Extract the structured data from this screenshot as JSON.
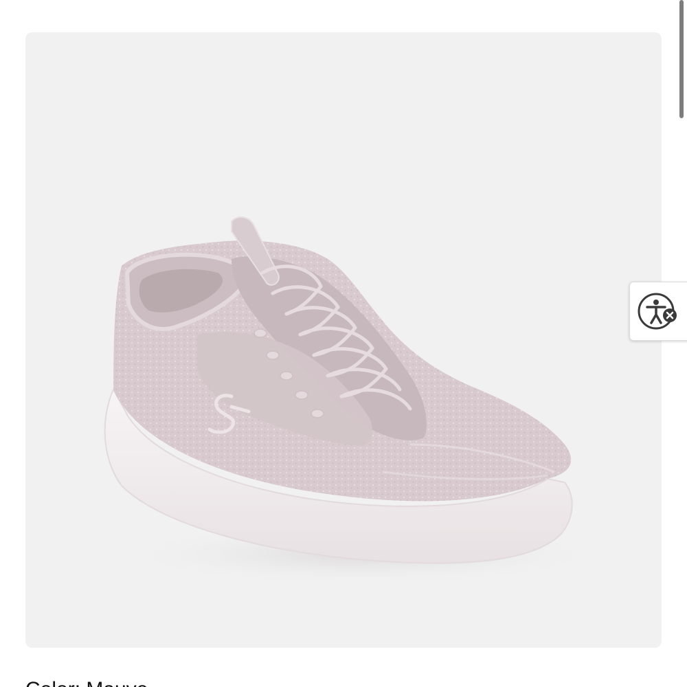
{
  "product": {
    "image_icon": "sneaker-image",
    "color_label": "Color: Mauve"
  },
  "accessibility": {
    "icon": "accessibility-person-icon",
    "close_icon": "close-x-icon"
  },
  "colors": {
    "frame_background": "#f1f1f1",
    "shoe_upper": "#d9cbcf",
    "shoe_sole": "#f4f1f2",
    "text": "#111111",
    "a11y_icon": "#3a3a3a"
  }
}
